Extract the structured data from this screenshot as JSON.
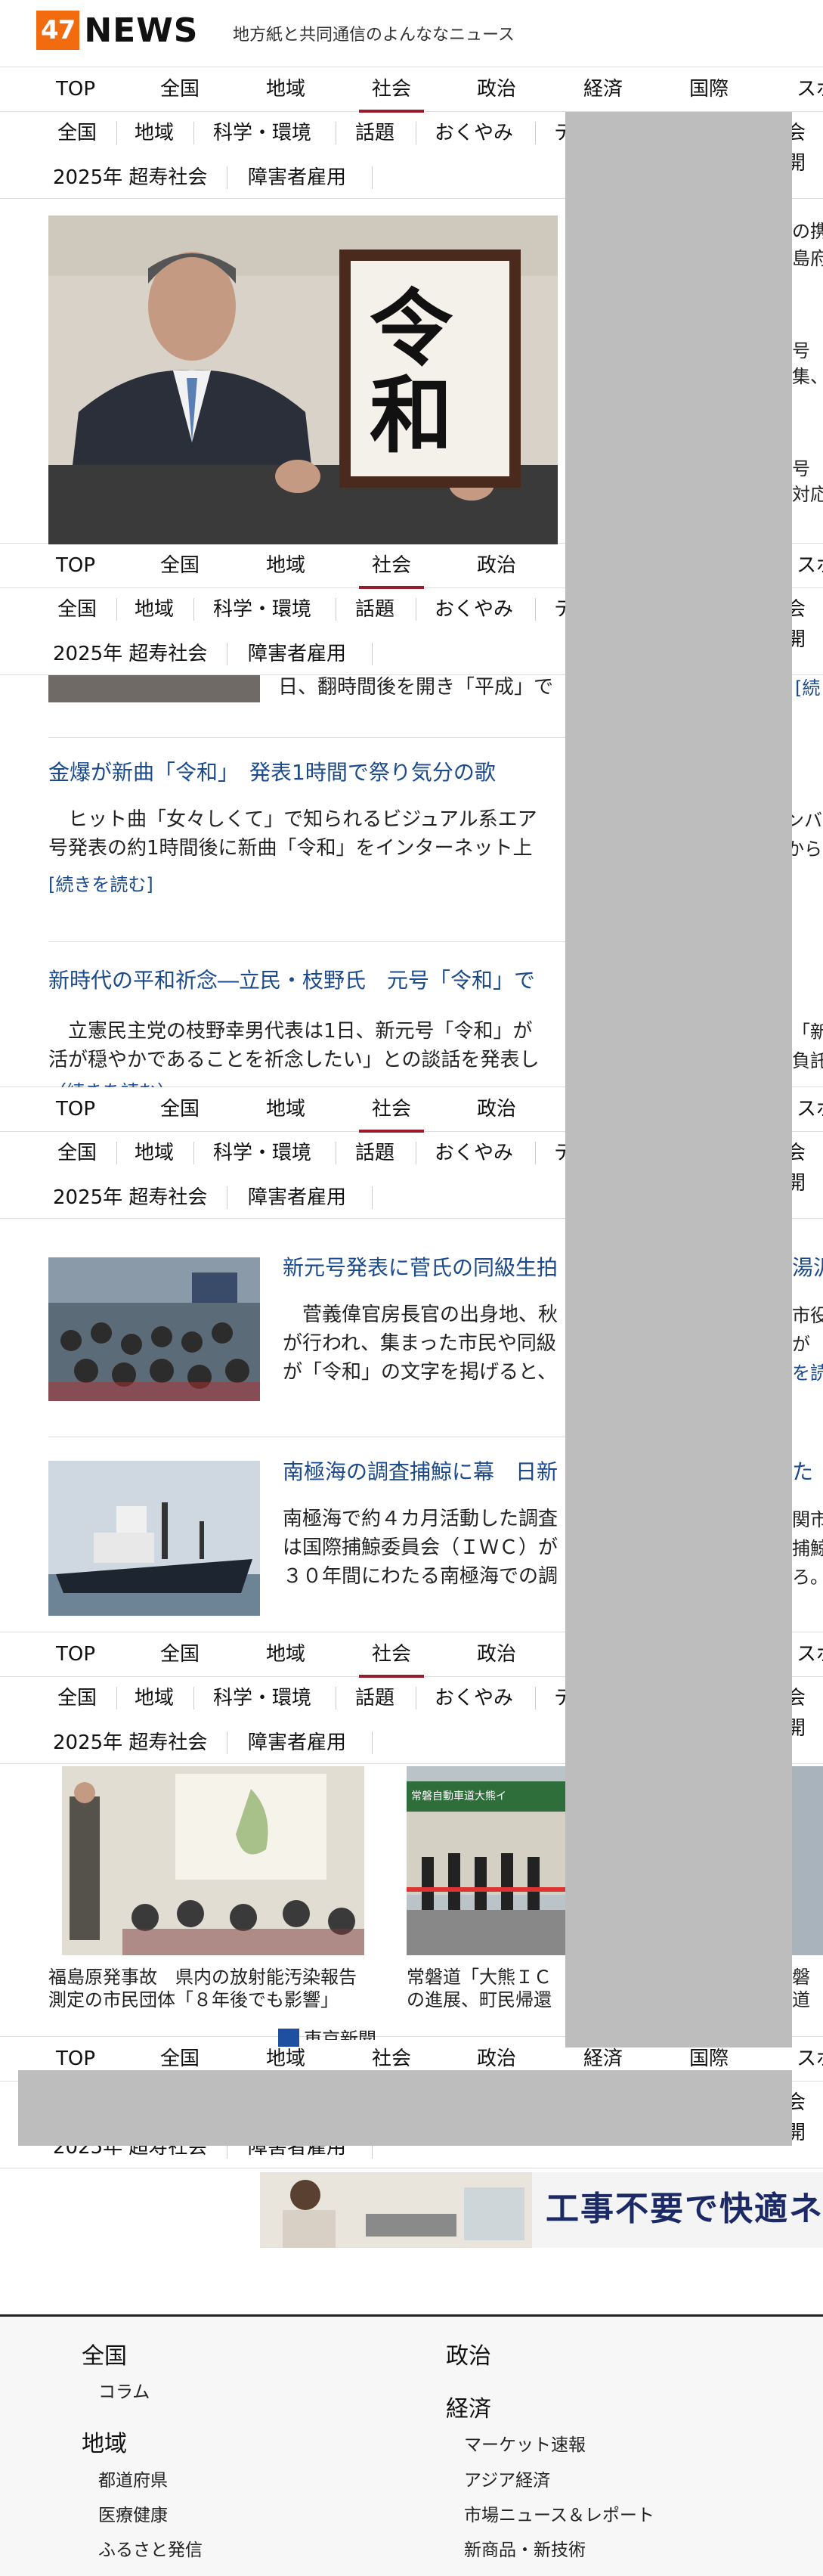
{
  "header": {
    "logo_num": "47",
    "logo_word": "NEWS",
    "tagline": "地方紙と共同通信のよんななニュース"
  },
  "nav": {
    "main": [
      "TOP",
      "全国",
      "地域",
      "社会",
      "政治",
      "経済",
      "国際",
      "スポ"
    ],
    "active": "社会",
    "sub_row1": [
      "全国",
      "地域",
      "科学・環境",
      "話題",
      "おくやみ",
      "テ",
      "会開"
    ],
    "sub_row2": [
      "2025年 超寿社会",
      "障害者雇用"
    ]
  },
  "articles": {
    "a1": {
      "body_tail": "日、翻時間後を開き「平成」で",
      "read_more_frag": "[続"
    },
    "a2": {
      "title": "金爆が新曲「令和」　発表1時間で祭り気分の歌",
      "body1": "　ヒット曲「女々しくて」で知られるビジュアル系エア",
      "body1_tail": "ンバ",
      "body2": "号発表の約1時間後に新曲「令和」をインターネット上",
      "body2_tail": "から分",
      "read_more": "[続きを読む]"
    },
    "a3": {
      "title": "新時代の平和祈念―立民・枝野氏　元号「令和」で",
      "body1": "　立憲民主党の枝野幸男代表は1日、新元号「令和」が",
      "body1_tail": "「新",
      "body2": "活が穏やかであることを祈念したい」との談話を発表し",
      "body2_tail": "負託",
      "read_more": "（続きを読む）"
    },
    "a4": {
      "title": "新元号発表に菅氏の同級生拍",
      "title_tail": "湯沢",
      "body1": "　菅義偉官房長官の出身地、秋",
      "body1_tail": "市役",
      "body2": "が行われ、集まった市民や同級",
      "body2_tail": "が",
      "body3": "が「令和」の文字を掲げると、",
      "body3_tail": "を読"
    },
    "a5": {
      "title": "南極海の調査捕鯨に幕　日新",
      "title_tail": "た",
      "body1": "南極海で約４カ月活動した調査",
      "body1_tail": "関市",
      "body2": "は国際捕鯨委員会（ＩＷＣ）が",
      "body2_tail": "捕鯨",
      "body3": "３０年間にわたる南極海での調",
      "body3_tail": "ろ。"
    },
    "right_fragments": [
      "の携",
      "島府",
      "号",
      "集、",
      "号",
      "対応"
    ]
  },
  "cards": [
    {
      "caption": "福島原発事故　県内の放射能汚染報告 測定の市民団体「８年後でも影響」",
      "source": "東京新聞"
    },
    {
      "caption": "常磐道「大熊ＩＣ の進展、町民帰還"
    },
    {
      "caption": "磐道"
    }
  ],
  "hero_placard": {
    "char1": "令",
    "char2": "和"
  },
  "photo_signs": {
    "sign": "常磐自動車道大熊イ"
  },
  "ad": {
    "text": "工事不要で快適ネ"
  },
  "footer": {
    "col1": [
      {
        "head": "全国",
        "links": [
          "コラム"
        ]
      },
      {
        "head": "地域",
        "links": [
          "都道府県",
          "医療健康",
          "ふるさと発信"
        ]
      }
    ],
    "col2": [
      {
        "head": "政治",
        "links": []
      },
      {
        "head": "経済",
        "links": [
          "マーケット速報",
          "アジア経済",
          "市場ニュース＆レポート",
          "新商品・新技術"
        ]
      }
    ]
  },
  "colors": {
    "logo_orange": "#f26b0f",
    "link_blue": "#1a4a8c",
    "active_underline": "#9a1b2a",
    "overlay_gray": "#bdbdbd"
  }
}
